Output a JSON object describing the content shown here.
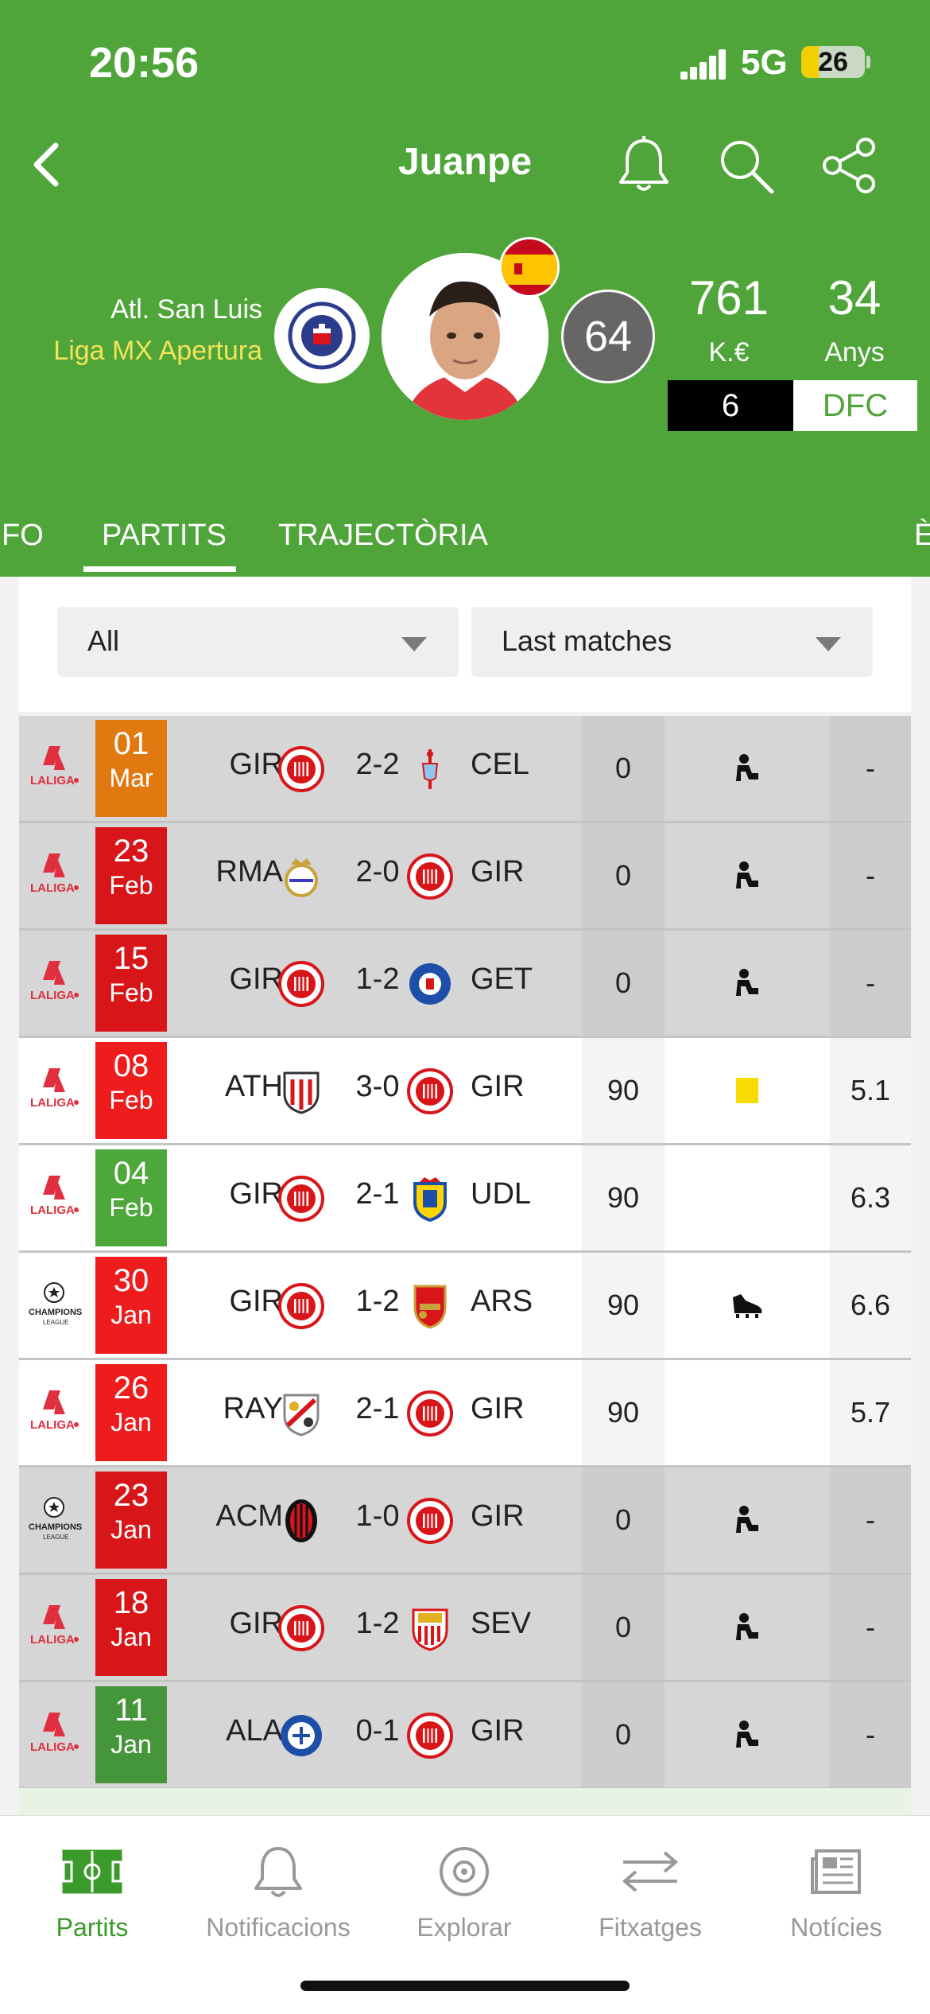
{
  "status_bar": {
    "time": "20:56",
    "network": "5G",
    "battery": "26"
  },
  "header": {
    "player_name": "Juanpe",
    "club": "Atl. San Luis",
    "league": "Liga MX Apertura",
    "rating": "64",
    "value": "761",
    "value_label": "K.€",
    "age": "34",
    "age_label": "Anys",
    "jersey_number": "6",
    "position": "DFC",
    "colors": {
      "primary": "#50a53a",
      "league_text": "#f4e35a"
    }
  },
  "tabs": [
    {
      "label": "FO"
    },
    {
      "label": "PARTITS",
      "active": true
    },
    {
      "label": "TRAJECTÒRIA"
    },
    {
      "label": "È"
    }
  ],
  "filters": {
    "competition": "All",
    "range": "Last matches"
  },
  "matches": [
    {
      "comp": "LALIGA",
      "day": "01",
      "month": "Mar",
      "date_color": "#e07a10",
      "home": "GIR",
      "home_crest": "girona",
      "score": "2-2",
      "away": "CEL",
      "away_crest": "celta",
      "minutes": "0",
      "event": "bench",
      "rating": "-",
      "bg": "gray"
    },
    {
      "comp": "LALIGA",
      "day": "23",
      "month": "Feb",
      "date_color": "#d8161a",
      "home": "RMA",
      "home_crest": "realmadrid",
      "score": "2-0",
      "away": "GIR",
      "away_crest": "girona",
      "minutes": "0",
      "event": "bench",
      "rating": "-",
      "bg": "gray"
    },
    {
      "comp": "LALIGA",
      "day": "15",
      "month": "Feb",
      "date_color": "#d8161a",
      "home": "GIR",
      "home_crest": "girona",
      "score": "1-2",
      "away": "GET",
      "away_crest": "getafe",
      "minutes": "0",
      "event": "bench",
      "rating": "-",
      "bg": "gray"
    },
    {
      "comp": "LALIGA",
      "day": "08",
      "month": "Feb",
      "date_color": "#ee1c1c",
      "home": "ATH",
      "home_crest": "athletic",
      "score": "3-0",
      "away": "GIR",
      "away_crest": "girona",
      "minutes": "90",
      "event": "yellow-card",
      "rating": "5.1",
      "bg": "white"
    },
    {
      "comp": "LALIGA",
      "day": "04",
      "month": "Feb",
      "date_color": "#4ea73a",
      "home": "GIR",
      "home_crest": "girona",
      "score": "2-1",
      "away": "UDL",
      "away_crest": "laspalmas",
      "minutes": "90",
      "event": "",
      "rating": "6.3",
      "bg": "white"
    },
    {
      "comp": "CHAMPIONS",
      "day": "30",
      "month": "Jan",
      "date_color": "#ee1c1c",
      "home": "GIR",
      "home_crest": "girona",
      "score": "1-2",
      "away": "ARS",
      "away_crest": "arsenal",
      "minutes": "90",
      "event": "boot",
      "rating": "6.6",
      "bg": "white"
    },
    {
      "comp": "LALIGA",
      "day": "26",
      "month": "Jan",
      "date_color": "#ee1c1c",
      "home": "RAY",
      "home_crest": "rayo",
      "score": "2-1",
      "away": "GIR",
      "away_crest": "girona",
      "minutes": "90",
      "event": "",
      "rating": "5.7",
      "bg": "white"
    },
    {
      "comp": "CHAMPIONS",
      "day": "23",
      "month": "Jan",
      "date_color": "#d8161a",
      "home": "ACM",
      "home_crest": "milan",
      "score": "1-0",
      "away": "GIR",
      "away_crest": "girona",
      "minutes": "0",
      "event": "bench",
      "rating": "-",
      "bg": "gray"
    },
    {
      "comp": "LALIGA",
      "day": "18",
      "month": "Jan",
      "date_color": "#d8161a",
      "home": "GIR",
      "home_crest": "girona",
      "score": "1-2",
      "away": "SEV",
      "away_crest": "sevilla",
      "minutes": "0",
      "event": "bench",
      "rating": "-",
      "bg": "gray"
    },
    {
      "comp": "LALIGA",
      "day": "11",
      "month": "Jan",
      "date_color": "#45953a",
      "home": "ALA",
      "home_crest": "alaves",
      "score": "0-1",
      "away": "GIR",
      "away_crest": "girona",
      "minutes": "0",
      "event": "bench",
      "rating": "-",
      "bg": "gray"
    }
  ],
  "bottom_nav": [
    {
      "label": "Partits",
      "icon": "pitch-icon",
      "active": true
    },
    {
      "label": "Notificacions",
      "icon": "bell-icon"
    },
    {
      "label": "Explorar",
      "icon": "compass-icon"
    },
    {
      "label": "Fitxatges",
      "icon": "transfer-icon"
    },
    {
      "label": "Notícies",
      "icon": "news-icon"
    }
  ]
}
